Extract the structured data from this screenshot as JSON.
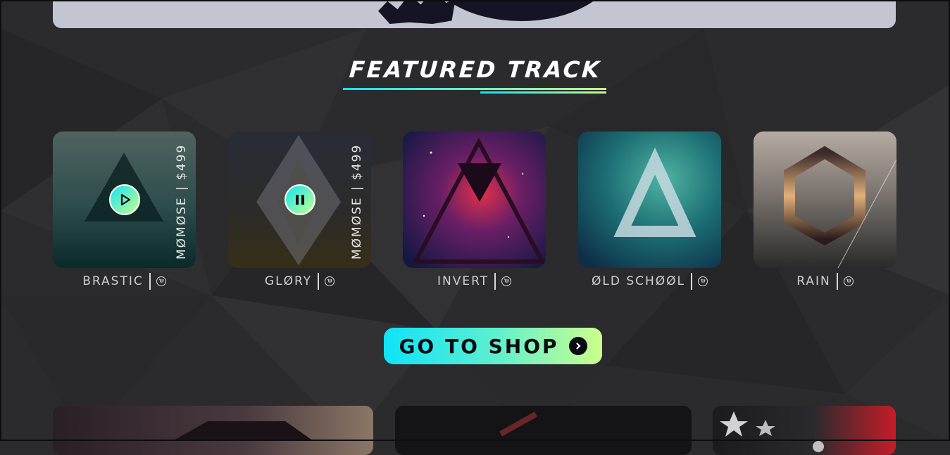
{
  "section": {
    "title": "FEATURED TRACK"
  },
  "tracks": [
    {
      "name": "BRASTIC",
      "artist": "MØMØSE",
      "price": "$499",
      "state": "play",
      "overlay": true
    },
    {
      "name": "GLØRY",
      "artist": "MØMØSE",
      "price": "$499",
      "state": "pause",
      "overlay": true
    },
    {
      "name": "INVERT",
      "artist": "",
      "price": "",
      "state": "none",
      "overlay": false
    },
    {
      "name": "ØLD SCHØØL",
      "artist": "",
      "price": "",
      "state": "none",
      "overlay": false
    },
    {
      "name": "RAIN",
      "artist": "",
      "price": "",
      "state": "none",
      "overlay": false
    }
  ],
  "cta": {
    "label": "GO TO SHOP"
  },
  "icons": {
    "play": "play-icon",
    "pause": "pause-icon",
    "cart": "cart-icon",
    "arrow": "chevron-right-icon"
  },
  "colors": {
    "accent_start": "#13e3f6",
    "accent_end": "#c7ff8a",
    "background": "#2c2c2e"
  }
}
